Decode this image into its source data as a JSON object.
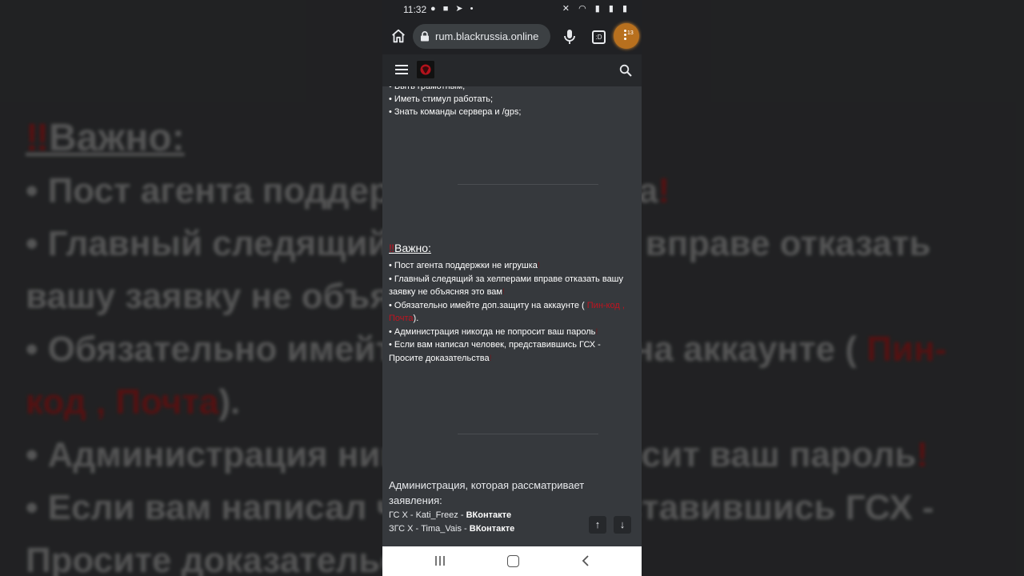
{
  "status_bar": {
    "time": "11:32"
  },
  "browser": {
    "url": "rum.blackrussia.online",
    "tab_count": ":D",
    "menu_badge": "13"
  },
  "content": {
    "requirements_tail": [
      "• Быть грамотным;",
      "• Иметь стимул работать;",
      "• Знать команды сервера и /gps;"
    ],
    "important": {
      "title": "Важно:",
      "items": [
        {
          "text": "• Пост агента поддержки не игрушка",
          "suffix": "!"
        },
        {
          "text": "• Главный следящий за хелперами вправе отказать вашу заявку не объясняя это вам",
          "suffix": "!"
        },
        {
          "text": "• Обязательно имейте доп.защиту на аккаунте ( ",
          "red": "Пин-код , Почта",
          "after": ")."
        },
        {
          "text": "• Администрация никогда не попросит ваш пароль",
          "suffix": "!"
        },
        {
          "text": "• Если вам написал человек, представившись ГСХ - Просите доказательства",
          "suffix": "!"
        }
      ]
    },
    "admin": {
      "heading": "Администрация, которая рассматривает заявления:",
      "rows": [
        {
          "role": "ГС Х - ",
          "name": "Kati_Freez",
          "sep": " - ",
          "link": "ВКонтакте"
        },
        {
          "role": "ЗГС Х - ",
          "name": "Tima_Vais",
          "sep": " - ",
          "link": "ВКонтакте"
        }
      ]
    }
  },
  "background_zoom": {
    "title": "Важно:",
    "lines": [
      "• Пост агента поддержки не игрушка",
      "• Главный следящий за хелперами вправе отказать",
      "вашу заявку не объясняя это вам",
      "• Обязательно имейте доп.защиту на аккаунте (",
      "код , Почта",
      "• Администрация никогда не попросит ваш пароль",
      "• Если вам написал человек, представившись ГСХ -",
      "Просите доказательства"
    ]
  },
  "icons": [
    "home-icon",
    "lock-icon",
    "mic-icon",
    "tabs-icon",
    "menu-icon",
    "hamburger-icon",
    "logo-icon",
    "search-icon",
    "arrow-up-icon",
    "arrow-down-icon",
    "recent-apps-icon",
    "home-nav-icon",
    "back-icon"
  ],
  "colors": {
    "page_bg": "#36393d",
    "accent_red": "#c0131f",
    "chrome_bar": "#202124"
  }
}
